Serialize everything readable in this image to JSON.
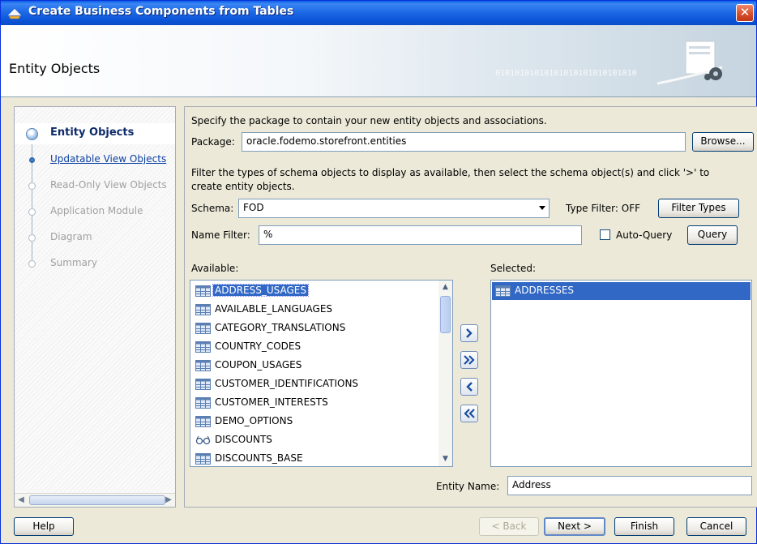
{
  "window": {
    "title": "Create Business Components from Tables"
  },
  "header": {
    "title": "Entity Objects",
    "binary_text": "01010101010101010101010101010"
  },
  "nav": {
    "items": [
      {
        "label": "Entity Objects",
        "state": "current"
      },
      {
        "label": "Updatable View Objects",
        "state": "link"
      },
      {
        "label": "Read-Only View Objects",
        "state": "disabled"
      },
      {
        "label": "Application Module",
        "state": "disabled"
      },
      {
        "label": "Diagram",
        "state": "disabled"
      },
      {
        "label": "Summary",
        "state": "disabled"
      }
    ]
  },
  "main": {
    "package_instructions": "Specify the package to contain your new entity objects and associations.",
    "package_label": "Package:",
    "package_value": "oracle.fodemo.storefront.entities",
    "browse_label": "Browse...",
    "filter_instructions_1": "Filter the types of schema objects to display as available, then select the schema object(s) and click '>' to",
    "filter_instructions_2": "create entity objects.",
    "schema_label": "Schema:",
    "schema_value": "FOD",
    "type_filter_text": "Type Filter: OFF",
    "filter_types_label": "Filter Types",
    "name_filter_label": "Name Filter:",
    "name_filter_value": "%",
    "auto_query_label": "Auto-Query",
    "query_label": "Query",
    "available_label": "Available:",
    "selected_label": "Selected:",
    "available_items": [
      {
        "label": "ADDRESS_USAGES",
        "icon": "table-icon"
      },
      {
        "label": "AVAILABLE_LANGUAGES",
        "icon": "table-icon"
      },
      {
        "label": "CATEGORY_TRANSLATIONS",
        "icon": "table-icon"
      },
      {
        "label": "COUNTRY_CODES",
        "icon": "table-icon"
      },
      {
        "label": "COUPON_USAGES",
        "icon": "table-icon"
      },
      {
        "label": "CUSTOMER_IDENTIFICATIONS",
        "icon": "table-icon"
      },
      {
        "label": "CUSTOMER_INTERESTS",
        "icon": "table-icon"
      },
      {
        "label": "DEMO_OPTIONS",
        "icon": "table-icon"
      },
      {
        "label": "DISCOUNTS",
        "icon": "view-icon"
      },
      {
        "label": "DISCOUNTS_BASE",
        "icon": "table-icon"
      }
    ],
    "selected_items": [
      {
        "label": "ADDRESSES",
        "icon": "table-icon"
      }
    ],
    "entity_name_label": "Entity Name:",
    "entity_name_value": "Address"
  },
  "buttons": {
    "help": "Help",
    "back": "< Back",
    "next": "Next >",
    "finish": "Finish",
    "cancel": "Cancel"
  },
  "colors": {
    "titlebar": "#0c55d8",
    "selection": "#3168c5",
    "dialog_bg": "#ece9d8"
  }
}
